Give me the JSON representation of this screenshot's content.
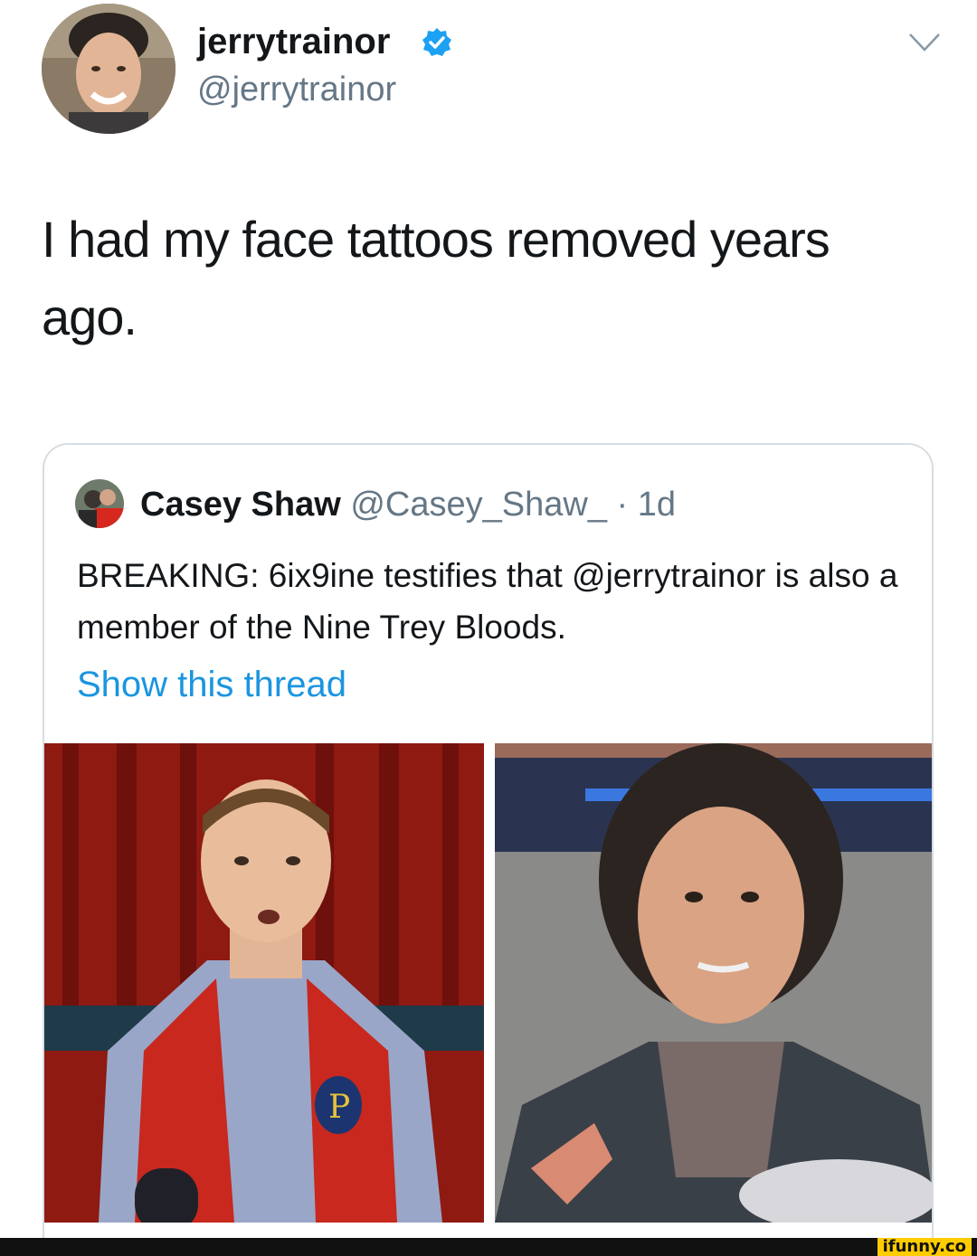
{
  "tweet": {
    "display_name": "jerrytrainor",
    "handle": "@jerrytrainor",
    "verified_icon": "verified-badge-icon",
    "menu_icon": "chevron-down-icon",
    "text": "I had my face tattoos removed years ago."
  },
  "quoted_tweet": {
    "name": "Casey Shaw",
    "handle": "@Casey_Shaw_",
    "separator": "·",
    "time": "1d",
    "text": "BREAKING: 6ix9ine testifies that @jerrytrainor is also a member of the Nine Trey Bloods.",
    "show_thread": "Show this thread"
  },
  "watermark": "ifunny.co",
  "colors": {
    "verified_blue": "#1da1f2",
    "link_blue": "#1b95e0",
    "muted_gray": "#657786",
    "card_border": "#d7dde2"
  }
}
